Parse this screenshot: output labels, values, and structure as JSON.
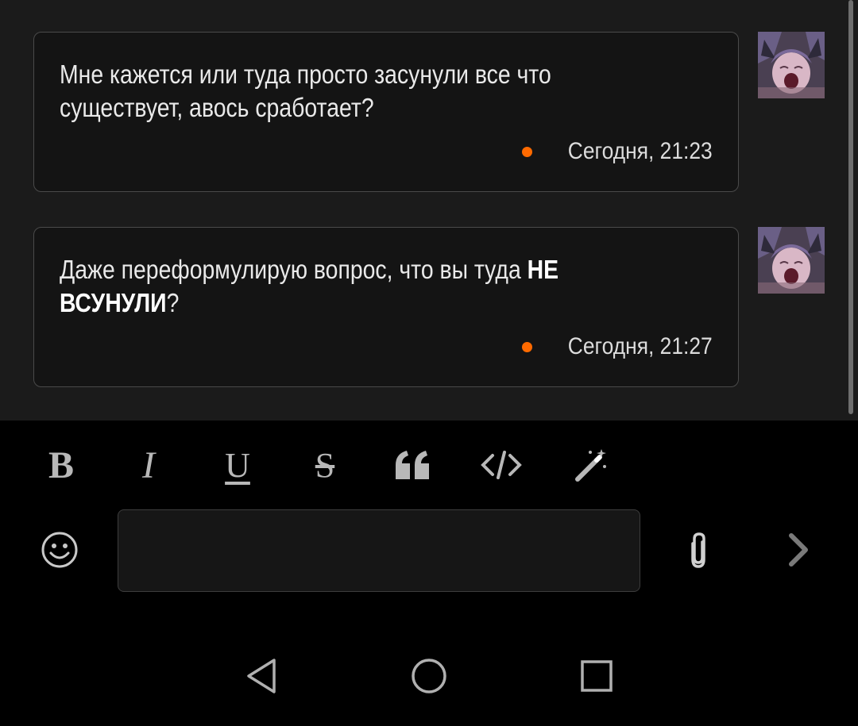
{
  "messages": [
    {
      "text_line1": "Мне кажется или туда просто засунули все что",
      "text_line2": "существует, авось сработает?",
      "timestamp": "Сегодня, 21:23"
    },
    {
      "text_line1_plain": "Даже переформулирую вопрос, что вы туда ",
      "text_line1_bold": "НЕ",
      "text_line2_bold": "ВСУНУЛИ",
      "text_line2_plain": "?",
      "timestamp": "Сегодня, 21:27"
    }
  ],
  "colors": {
    "accent_dot": "#ff6a00",
    "chat_background": "#1b1b1b",
    "bubble_background": "#141414",
    "bubble_border": "#4a4a4a"
  },
  "toolbar": {
    "tools": [
      {
        "icon": "bold-icon",
        "glyph": "B"
      },
      {
        "icon": "italic-icon",
        "glyph": "I"
      },
      {
        "icon": "underline-icon",
        "glyph": "U"
      },
      {
        "icon": "strikethrough-icon",
        "glyph": "S"
      },
      {
        "icon": "quote-icon",
        "glyph": "❝"
      },
      {
        "icon": "code-icon",
        "glyph": "</>"
      },
      {
        "icon": "magic-wand-icon",
        "glyph": "✦"
      }
    ]
  },
  "composer": {
    "input_value": "",
    "input_placeholder": "",
    "emoji_icon": "smiley-icon",
    "attach_icon": "paperclip-icon",
    "send_icon": "chevron-right-icon"
  },
  "navigation": {
    "back_icon": "triangle-back-icon",
    "home_icon": "circle-home-icon",
    "recents_icon": "square-recents-icon"
  }
}
